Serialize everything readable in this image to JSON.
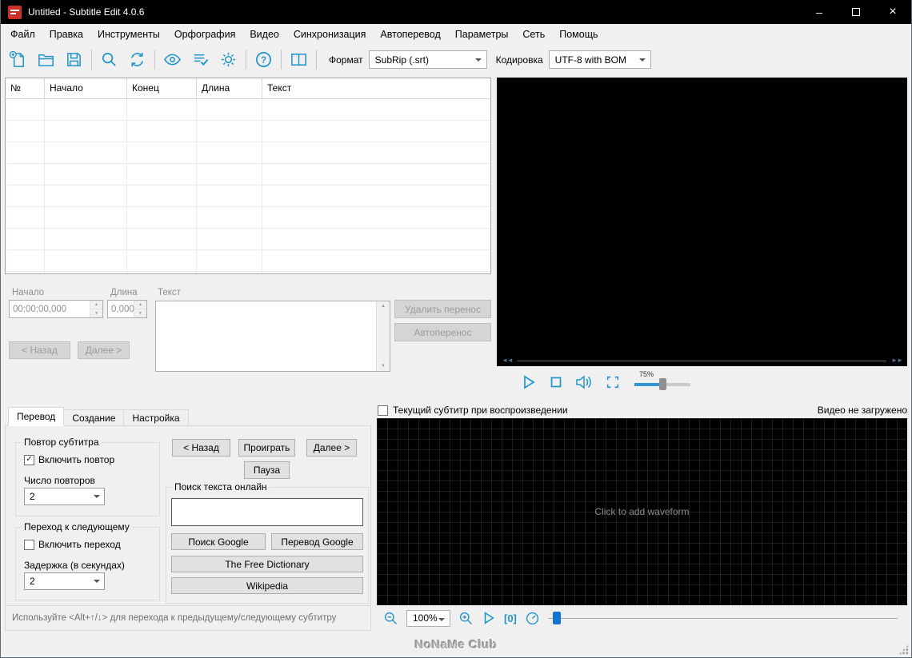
{
  "window": {
    "title": "Untitled - Subtitle Edit 4.0.6"
  },
  "glyphs": {
    "minimize": "–",
    "close": "×",
    "seek_back": "◄◄",
    "seek_fwd": "►►"
  },
  "menu": {
    "items": [
      "Файл",
      "Правка",
      "Инструменты",
      "Орфография",
      "Видео",
      "Синхронизация",
      "Автоперевод",
      "Параметры",
      "Сеть",
      "Помощь"
    ]
  },
  "toolbar": {
    "format_label": "Формат",
    "format_value": "SubRip (.srt)",
    "encoding_label": "Кодировка",
    "encoding_value": "UTF-8 with BOM"
  },
  "subtitle_table": {
    "columns": [
      "№",
      "Начало",
      "Конец",
      "Длина",
      "Текст"
    ]
  },
  "edit_panel": {
    "start_label": "Начало",
    "start_value": "00:00:00,000",
    "duration_label": "Длина",
    "duration_value": "0,000",
    "text_label": "Текст",
    "remove_break": "Удалить перенос",
    "autobreak": "Автоперенос",
    "prev": "< Назад",
    "next": "Далее >"
  },
  "video": {
    "volume": "75%"
  },
  "tabs": {
    "translate": "Перевод",
    "create": "Создание",
    "adjust": "Настройка"
  },
  "translate": {
    "repeat_group": "Повтор субтитра",
    "repeat_checkbox": "Включить повтор",
    "repeat_count_label": "Число повторов",
    "repeat_count": "2",
    "goto_group": "Переход к следующему",
    "goto_checkbox": "Включить переход",
    "delay_label": "Задержка (в секундах)",
    "delay": "2",
    "back": "< Назад",
    "play": "Проиграть",
    "next": "Далее >",
    "pause": "Пауза",
    "search_group": "Поиск текста онлайн",
    "search_value": "",
    "google_search": "Поиск Google",
    "google_translate": "Перевод Google",
    "dictionary": "The Free Dictionary",
    "wikipedia": "Wikipedia",
    "hint": "Используйте <Alt+↑/↓> для перехода к предыдущему/следующему субтитру"
  },
  "waveform": {
    "show_subtitle": "Текущий субтитр при воспроизведении",
    "video_status": "Видео не загружено",
    "hint": "Click to add waveform",
    "zoom": "100%",
    "center_glyph": "[0]"
  },
  "statusbar": {
    "watermark": "NoNaMe Club"
  },
  "colors": {
    "accent": "#2095c9",
    "titlebar": "#000000",
    "app_icon": "#c9312b"
  }
}
